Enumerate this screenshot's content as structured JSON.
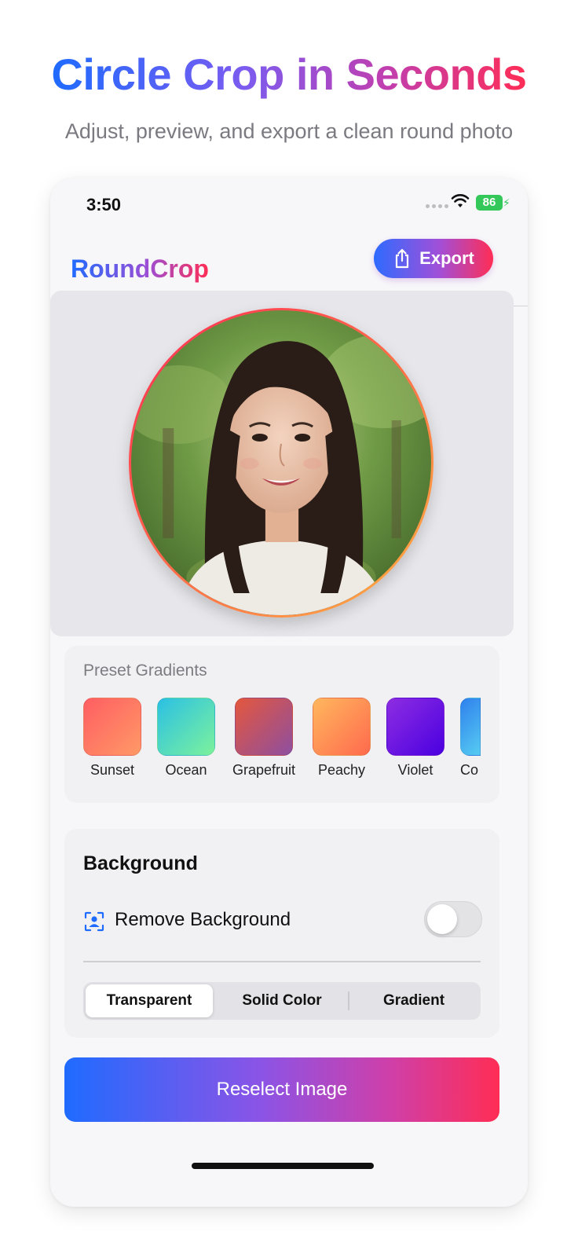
{
  "promo": {
    "headline": "Circle Crop in Seconds",
    "subheadline": "Adjust, preview, and export a clean round photo"
  },
  "status_bar": {
    "time": "3:50",
    "battery": "86",
    "battery_color": "#34c759",
    "icons": [
      "signal-icon",
      "wifi-icon",
      "battery-icon"
    ]
  },
  "nav": {
    "app_title": "RoundCrop",
    "export_label": "Export",
    "export_icon": "share-icon"
  },
  "preview": {
    "photo": "circular-cropped-portrait",
    "border_gradient": [
      "#ff2d55",
      "#ffb23f"
    ]
  },
  "presets": {
    "label": "Preset Gradients",
    "items": [
      {
        "name": "Sunset",
        "colors": [
          "#ff5e62",
          "#ff9966"
        ]
      },
      {
        "name": "Ocean",
        "colors": [
          "#2bc0e4",
          "#7cf29c"
        ]
      },
      {
        "name": "Grapefruit",
        "colors": [
          "#e4573d",
          "#8e4fa0"
        ]
      },
      {
        "name": "Peachy",
        "colors": [
          "#ffb75e",
          "#ff6a4d"
        ]
      },
      {
        "name": "Violet",
        "colors": [
          "#8e2de2",
          "#4a00e0"
        ]
      },
      {
        "name": "Co",
        "colors": [
          "#2f80ed",
          "#56ccf2"
        ]
      }
    ]
  },
  "background": {
    "title": "Background",
    "remove_label": "Remove Background",
    "remove_icon": "person-crop-icon",
    "remove_enabled": false,
    "segments": [
      "Transparent",
      "Solid Color",
      "Gradient"
    ],
    "selected_segment": "Transparent"
  },
  "actions": {
    "reselect_label": "Reselect Image"
  },
  "colors": {
    "brand_blue": "#1f6bff",
    "brand_pink": "#ff2d55",
    "brand_purple": "#9b4fd6"
  }
}
